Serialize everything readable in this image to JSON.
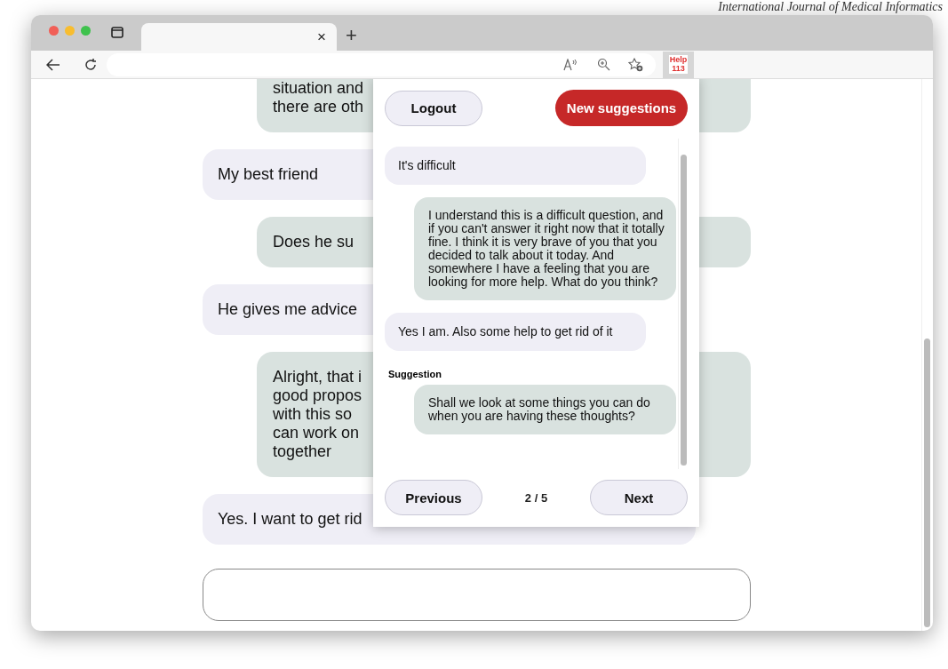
{
  "caption": "International Journal of Medical Informatics",
  "browser": {
    "tab_close": "×",
    "new_tab": "+",
    "extension_badge": "Help\n113"
  },
  "chat": {
    "messages": [
      {
        "kind": "reply",
        "text": "situation and\nthere are oth"
      },
      {
        "kind": "own",
        "text": "My best friend"
      },
      {
        "kind": "reply",
        "text": "Does he su"
      },
      {
        "kind": "own",
        "text": "He gives me advice"
      },
      {
        "kind": "reply",
        "text": "Alright, that i\ngood propos\nwith this so\ncan work on\ntogether"
      },
      {
        "kind": "own",
        "text": "Yes. I want to get rid"
      }
    ]
  },
  "panel": {
    "logout": "Logout",
    "new_suggestions": "New suggestions",
    "messages": [
      {
        "kind": "own",
        "text": "It's difficult"
      },
      {
        "kind": "reply",
        "text": "I understand this is a difficult question, and if you can't answer it right now that it totally fine. I think it is very brave of you that you decided to talk about it today. And somewhere I have a feeling that you are looking for more help. What do you think?"
      },
      {
        "kind": "own",
        "text": "Yes I am. Also some help to get rid of it"
      },
      {
        "kind": "reply",
        "label": "Suggestion",
        "text": "Shall we look at some things you can do when you are having these thoughts?"
      }
    ],
    "pager": {
      "previous": "Previous",
      "page": "2 / 5",
      "next": "Next"
    }
  }
}
